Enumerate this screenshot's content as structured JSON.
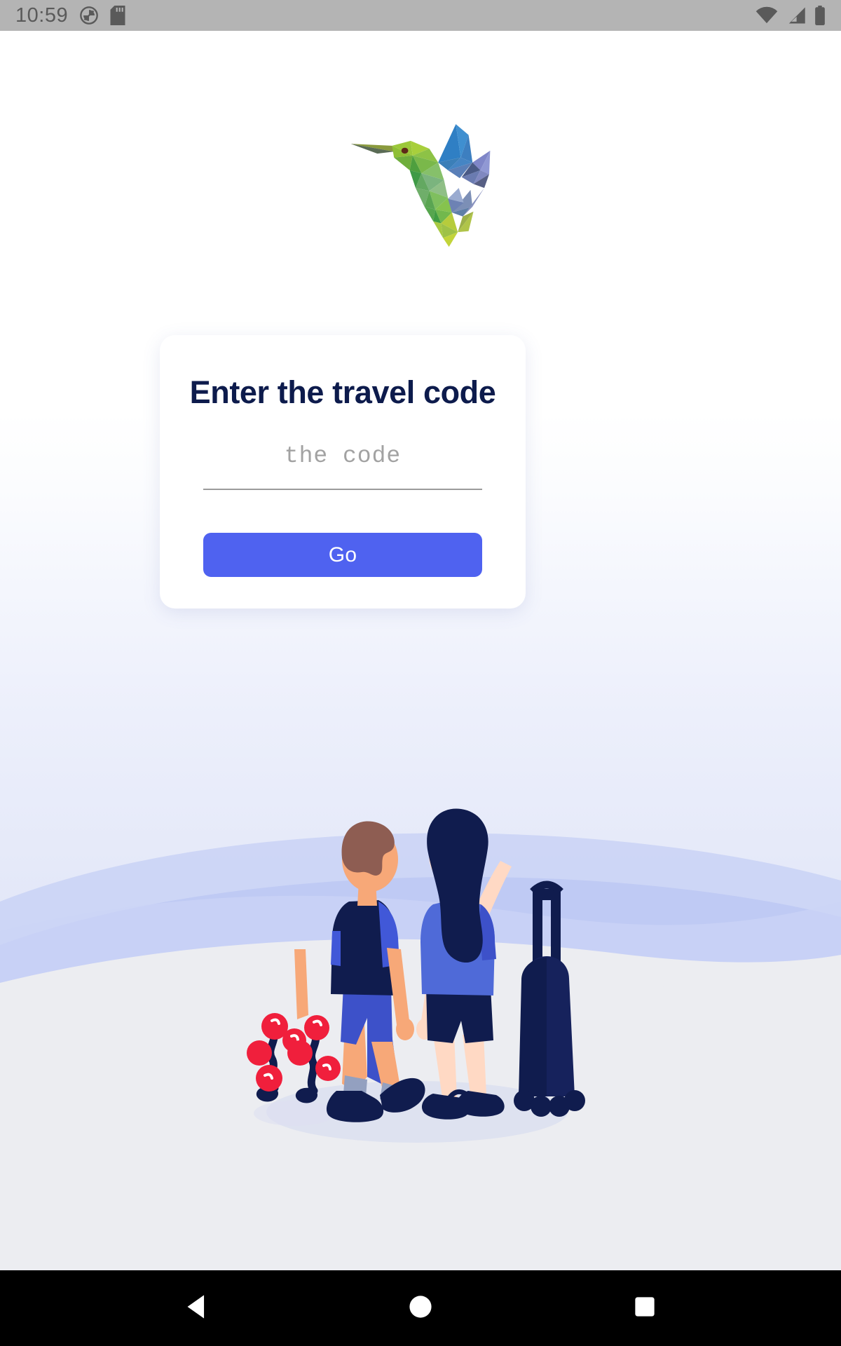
{
  "status_bar": {
    "time": "10:59",
    "left_icons": [
      "do-not-disturb-icon",
      "sd-card-icon"
    ],
    "right_icons": [
      "wifi-icon",
      "cellular-signal-icon",
      "battery-icon"
    ],
    "background_color": "#b4b4b4"
  },
  "app": {
    "logo_name": "hummingbird-logo",
    "brand_colors": {
      "accent": "#4f62f0",
      "title": "#0d1b4c",
      "page_bottom": "#dfe4f7"
    }
  },
  "card": {
    "title": "Enter the travel code",
    "input": {
      "value": "",
      "placeholder": "the code"
    },
    "submit_label": "Go"
  },
  "illustration": {
    "name": "couple-walking-with-suitcase",
    "elements": [
      "man-walking",
      "woman-pointing",
      "rolling-suitcase",
      "red-berry-plant-left",
      "red-berry-plant-right"
    ],
    "colors": {
      "skin_light": "#ffd9c4",
      "skin_tan": "#f7a878",
      "navy": "#101c4e",
      "blue": "#4158d8",
      "periwinkle": "#6878e0",
      "hair_brown": "#8e5d52",
      "berry_red": "#f01f3c",
      "ground": "#ecedf1"
    }
  },
  "nav_bar": {
    "buttons": [
      {
        "name": "back-button",
        "icon": "triangle-back-icon"
      },
      {
        "name": "home-button",
        "icon": "circle-home-icon"
      },
      {
        "name": "recents-button",
        "icon": "square-recents-icon"
      }
    ]
  }
}
